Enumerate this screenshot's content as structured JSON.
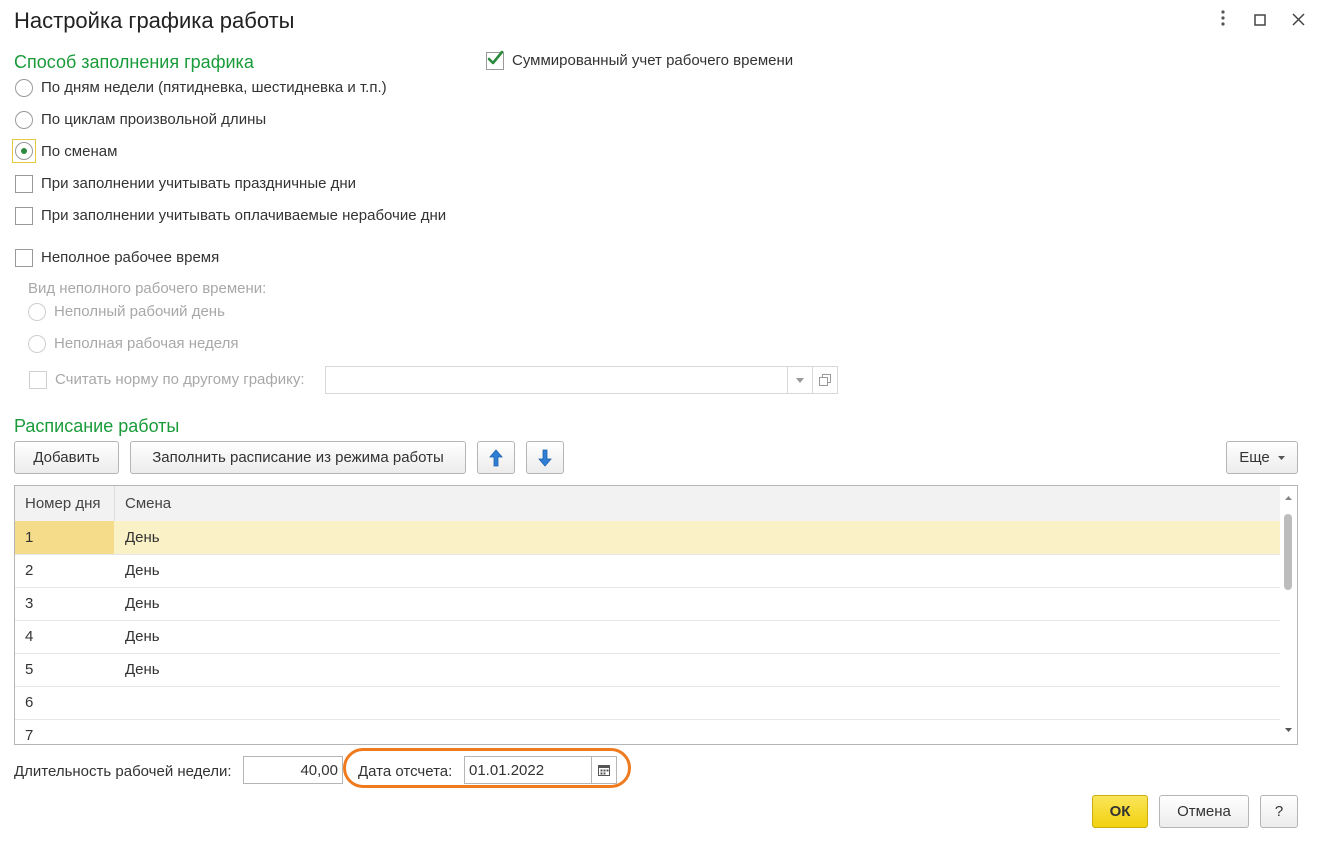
{
  "window": {
    "title": "Настройка графика работы"
  },
  "fill_method": {
    "section_title": "Способ заполнения графика",
    "options": [
      {
        "label": "По дням недели (пятидневка, шестидневка и т.п.)",
        "selected": false
      },
      {
        "label": "По циклам произвольной длины",
        "selected": false
      },
      {
        "label": "По сменам",
        "selected": true
      }
    ],
    "consider_holidays_label": "При заполнении учитывать праздничные дни",
    "consider_holidays_checked": false,
    "consider_paid_nonworking_label": "При заполнении учитывать оплачиваемые нерабочие дни",
    "consider_paid_nonworking_checked": false,
    "summary_time_label": "Суммированный учет рабочего времени",
    "summary_time_checked": true
  },
  "part_time": {
    "label": "Неполное рабочее время",
    "checked": false,
    "kind_label": "Вид неполного рабочего времени:",
    "options": [
      {
        "label": "Неполный рабочий день"
      },
      {
        "label": "Неполная рабочая неделя"
      }
    ],
    "norm_other_schedule_label": "Считать норму по другому графику:",
    "norm_other_schedule_value": ""
  },
  "schedule": {
    "section_title": "Расписание работы",
    "add_button": "Добавить",
    "fill_button": "Заполнить расписание из режима работы",
    "more_button": "Еще",
    "columns": [
      "Номер дня",
      "Смена"
    ],
    "rows": [
      {
        "day": "1",
        "shift": "День"
      },
      {
        "day": "2",
        "shift": "День"
      },
      {
        "day": "3",
        "shift": "День"
      },
      {
        "day": "4",
        "shift": "День"
      },
      {
        "day": "5",
        "shift": "День"
      },
      {
        "day": "6",
        "shift": ""
      },
      {
        "day": "7",
        "shift": ""
      }
    ]
  },
  "footer": {
    "week_length_label": "Длительность рабочей недели:",
    "week_length_value": "40,00",
    "ref_date_label": "Дата отсчета:",
    "ref_date_value": "01.01.2022",
    "ok_button": "ОК",
    "cancel_button": "Отмена",
    "help_button": "?"
  },
  "colors": {
    "section_title": "#1a9b3a",
    "highlight": "#f07b1f",
    "ok_button": "#f1d10f",
    "selected_row": "#fbf1c6",
    "arrow_blue": "#2f7fd6"
  },
  "icons": {
    "menu": "more-vertical-icon",
    "maximize": "maximize-icon",
    "close": "close-icon",
    "up": "arrow-up-icon",
    "down": "arrow-down-icon",
    "calendar": "calendar-icon",
    "dropdown": "chevron-down-icon",
    "open": "open-form-icon"
  }
}
